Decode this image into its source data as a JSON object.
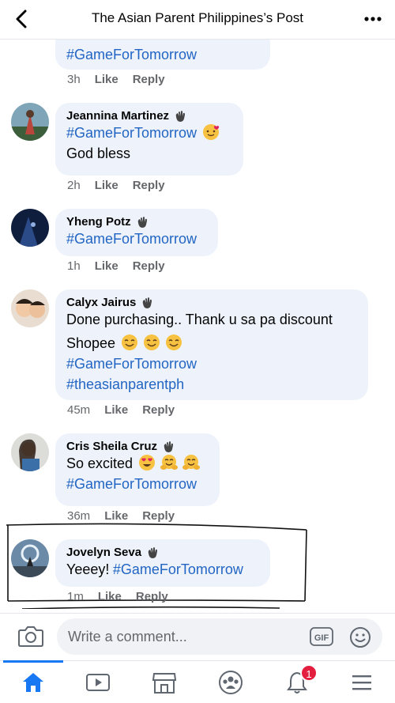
{
  "header": {
    "title": "The Asian Parent Philippines’s Post"
  },
  "comments": [
    {
      "author": "",
      "lines": [],
      "tags": [
        "#GameForTomorrow"
      ],
      "time": "3h",
      "like": "Like",
      "reply": "Reply"
    },
    {
      "author": "Jeannina Martinez",
      "tags_first": [
        "#GameForTomorrow"
      ],
      "lines": [
        "God bless"
      ],
      "time": "2h",
      "like": "Like",
      "reply": "Reply"
    },
    {
      "author": "Yheng Potz",
      "tags": [
        "#GameForTomorrow"
      ],
      "time": "1h",
      "like": "Like",
      "reply": "Reply"
    },
    {
      "author": "Calyx Jairus",
      "lines": [
        "Done purchasing.. Thank u sa pa discount",
        "Shopee"
      ],
      "tags": [
        "#GameForTomorrow",
        "#theasianparentph"
      ],
      "time": "45m",
      "like": "Like",
      "reply": "Reply"
    },
    {
      "author": "Cris Sheila Cruz",
      "lines": [
        "So excited"
      ],
      "tags": [
        "#GameForTomorrow"
      ],
      "time": "36m",
      "like": "Like",
      "reply": "Reply"
    },
    {
      "author": "Jovelyn Seva",
      "lines": [
        "Yeeey!"
      ],
      "tags": [
        "#GameForTomorrow"
      ],
      "time": "1m",
      "like": "Like",
      "reply": "Reply"
    }
  ],
  "composer": {
    "placeholder": "Write a comment..."
  },
  "tabbar": {
    "notifications_badge": "1"
  },
  "colors": {
    "accent": "#1877f2",
    "hashtag": "#2265c3",
    "bubble": "#eef3fb",
    "badge": "#e41e3f"
  }
}
